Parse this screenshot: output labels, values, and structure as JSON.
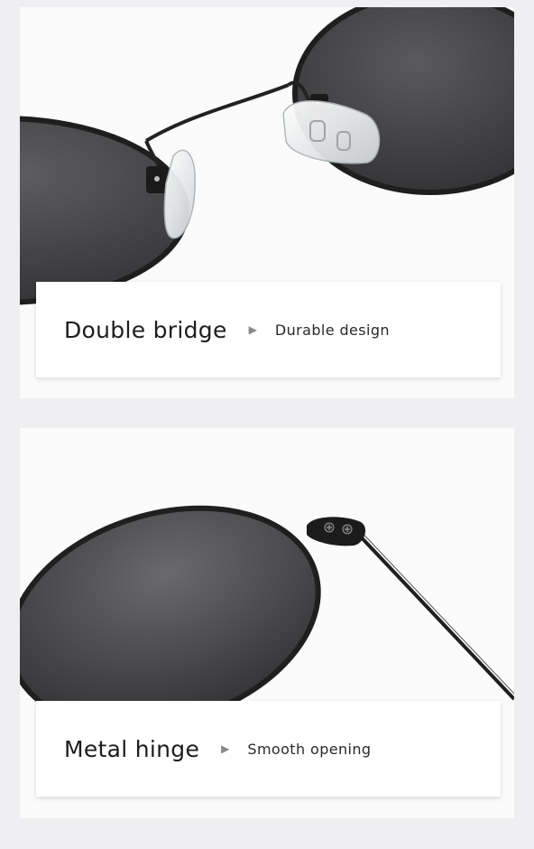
{
  "sections": [
    {
      "headline": "Double bridge",
      "arrow_icon": "play-arrow-icon",
      "subline": "Durable design"
    },
    {
      "headline": "Metal hinge",
      "arrow_icon": "play-arrow-icon",
      "subline": "Smooth opening"
    }
  ],
  "colors": {
    "background": "#efeef0",
    "frame": "#1e1e1e",
    "lens": "#4a4a4c"
  }
}
